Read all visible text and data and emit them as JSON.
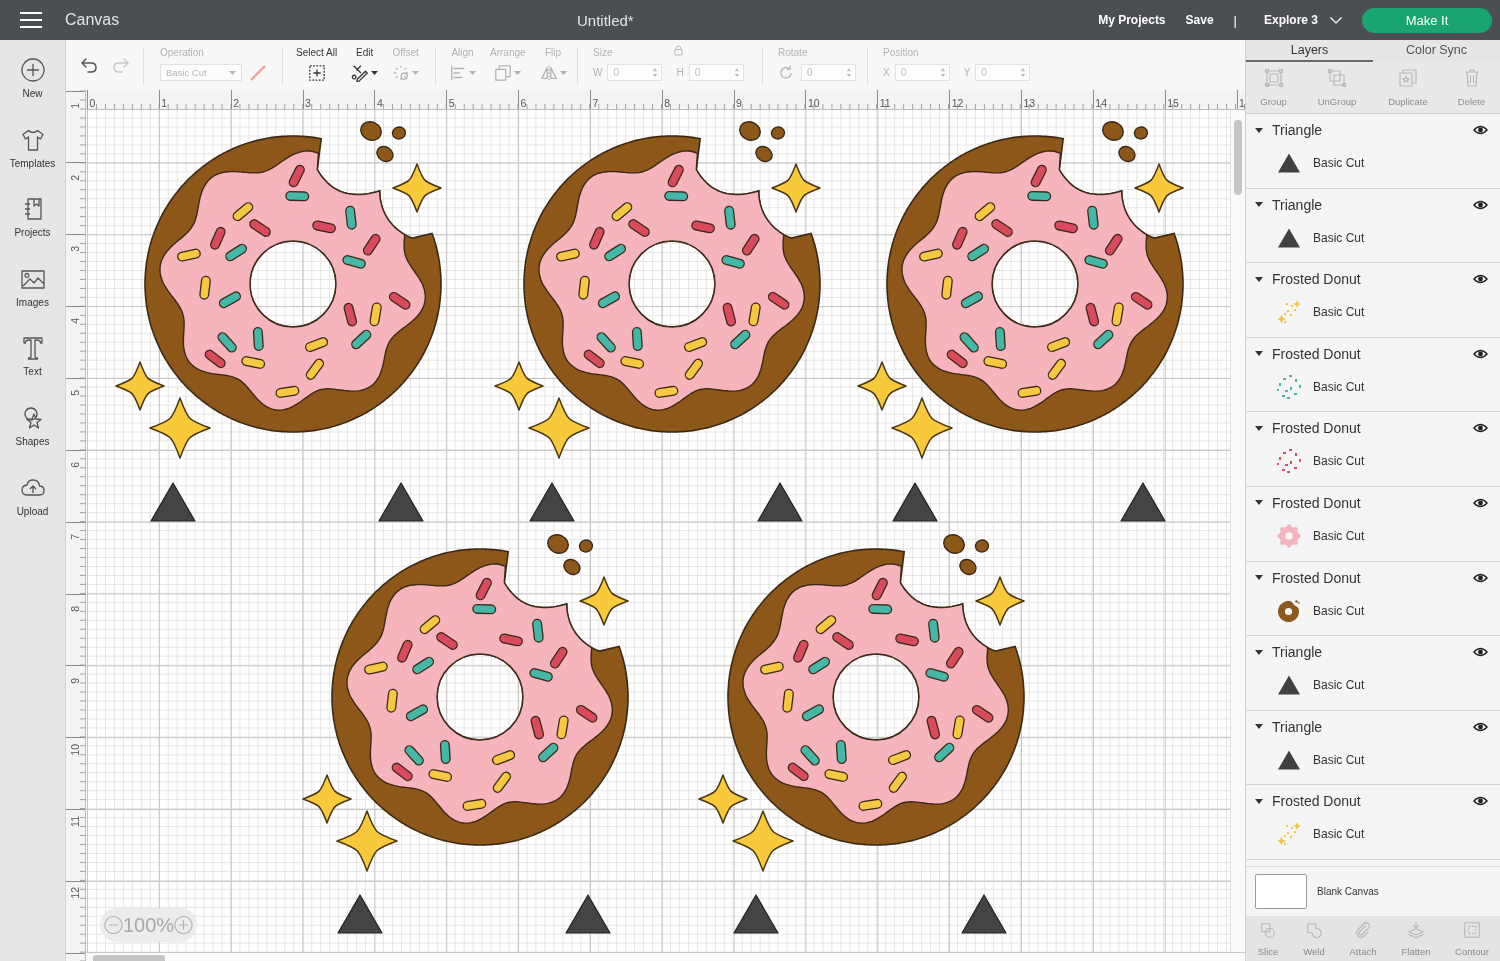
{
  "top_bar": {
    "app_title": "Canvas",
    "document_title": "Untitled*",
    "links": [
      "My Projects",
      "Save"
    ],
    "separator": "|",
    "machine": "Explore 3",
    "action_button": "Make It"
  },
  "sidebar": {
    "items": [
      {
        "label": "New"
      },
      {
        "label": "Templates"
      },
      {
        "label": "Projects"
      },
      {
        "label": "Images"
      },
      {
        "label": "Text"
      },
      {
        "label": "Shapes"
      },
      {
        "label": "Upload"
      }
    ]
  },
  "toolbar": {
    "undo": {
      "disabled": false
    },
    "redo": {
      "disabled": true
    },
    "operation": {
      "label": "Operation",
      "value": "Basic Cut",
      "disabled": true
    },
    "select_all": {
      "label": "Select All",
      "disabled": false
    },
    "edit": {
      "label": "Edit",
      "disabled": false
    },
    "offset": {
      "label": "Offset",
      "disabled": true
    },
    "align": {
      "label": "Align",
      "disabled": true
    },
    "arrange": {
      "label": "Arrange",
      "disabled": true
    },
    "flip": {
      "label": "Flip",
      "disabled": true
    },
    "size": {
      "label": "Size",
      "disabled": true,
      "fields": [
        {
          "label": "W",
          "value": "0"
        },
        {
          "label": "H",
          "value": "0"
        }
      ]
    },
    "rotate": {
      "label": "Rotate",
      "disabled": true,
      "value": "0"
    },
    "position": {
      "label": "Position",
      "disabled": true,
      "fields": [
        {
          "label": "X",
          "value": "0"
        },
        {
          "label": "Y",
          "value": "0"
        }
      ]
    }
  },
  "rulers": {
    "horizontal": [
      "0",
      "1",
      "2",
      "3",
      "4",
      "5",
      "6",
      "7",
      "8",
      "9",
      "10",
      "11",
      "12",
      "13",
      "14",
      "15",
      "1"
    ],
    "vertical": [
      "1",
      "2",
      "3",
      "4",
      "5",
      "6",
      "7",
      "8",
      "9",
      "10",
      "11",
      "12"
    ]
  },
  "zoom": {
    "value": "100%"
  },
  "panel": {
    "tabs": [
      {
        "label": "Layers",
        "selected": true
      },
      {
        "label": "Color Sync",
        "selected": false
      }
    ],
    "tools": [
      {
        "label": "Group",
        "disabled": true
      },
      {
        "label": "UnGroup",
        "disabled": true
      },
      {
        "label": "Duplicate",
        "disabled": true
      },
      {
        "label": "Delete",
        "disabled": true
      }
    ],
    "layers": [
      {
        "name": "Triangle",
        "selected": false,
        "expanded": true,
        "visible": true,
        "children": [
          {
            "operation": "Basic Cut",
            "kind": "triangle",
            "color": "#414141"
          }
        ]
      },
      {
        "name": "Triangle",
        "selected": false,
        "expanded": true,
        "visible": true,
        "children": [
          {
            "operation": "Basic Cut",
            "kind": "triangle",
            "color": "#414141"
          }
        ]
      },
      {
        "name": "Frosted Donut",
        "selected": false,
        "expanded": true,
        "visible": true,
        "children": [
          {
            "operation": "Basic Cut",
            "kind": "sparkles",
            "color": "#f4c443"
          }
        ]
      },
      {
        "name": "Frosted Donut",
        "selected": false,
        "expanded": true,
        "visible": true,
        "children": [
          {
            "operation": "Basic Cut",
            "kind": "sprinkles",
            "color": "#4ab5a6"
          }
        ]
      },
      {
        "name": "Frosted Donut",
        "selected": false,
        "expanded": true,
        "visible": true,
        "children": [
          {
            "operation": "Basic Cut",
            "kind": "sprinkles",
            "color": "#d6505e"
          }
        ]
      },
      {
        "name": "Frosted Donut",
        "selected": false,
        "expanded": true,
        "visible": true,
        "children": [
          {
            "operation": "Basic Cut",
            "kind": "frosting",
            "color": "#f5b4bd"
          }
        ]
      },
      {
        "name": "Frosted Donut",
        "selected": false,
        "expanded": true,
        "visible": true,
        "children": [
          {
            "operation": "Basic Cut",
            "kind": "donut",
            "color": "#8b5a1e"
          }
        ]
      },
      {
        "name": "Triangle",
        "selected": false,
        "expanded": true,
        "visible": true,
        "children": [
          {
            "operation": "Basic Cut",
            "kind": "triangle",
            "color": "#414141"
          }
        ]
      },
      {
        "name": "Triangle",
        "selected": false,
        "expanded": true,
        "visible": true,
        "children": [
          {
            "operation": "Basic Cut",
            "kind": "triangle",
            "color": "#414141"
          }
        ]
      },
      {
        "name": "Frosted Donut",
        "selected": false,
        "expanded": true,
        "visible": true,
        "children": [
          {
            "operation": "Basic Cut",
            "kind": "sparkles",
            "color": "#f4c443"
          }
        ]
      }
    ],
    "blank_canvas": "Blank Canvas",
    "bottom_tools": [
      {
        "label": "Slice",
        "disabled": true
      },
      {
        "label": "Weld",
        "disabled": true
      },
      {
        "label": "Attach",
        "disabled": true
      },
      {
        "label": "Flatten",
        "disabled": true
      },
      {
        "label": "Contour",
        "disabled": true
      }
    ]
  }
}
